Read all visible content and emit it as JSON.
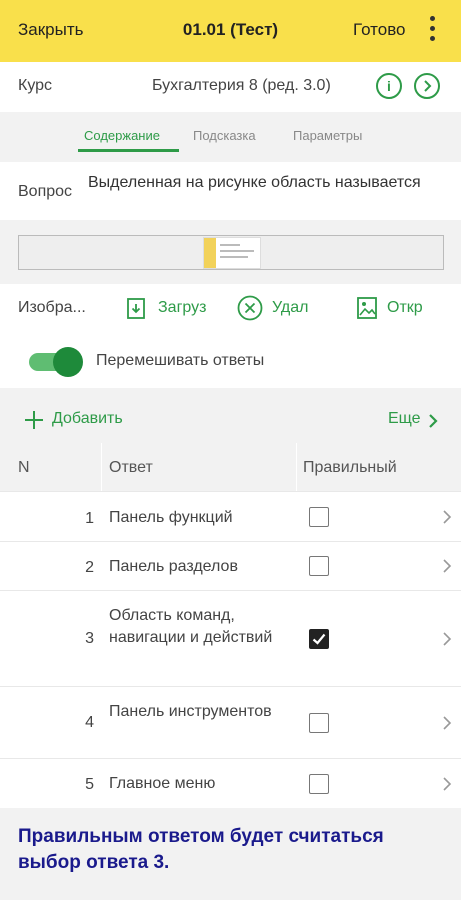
{
  "header": {
    "close_label": "Закрыть",
    "title": "01.01 (Тест)",
    "done_label": "Готово"
  },
  "course": {
    "label": "Курс",
    "value": "Бухгалтерия 8 (ред. 3.0)"
  },
  "tabs": [
    {
      "label": "Содержание",
      "active": true
    },
    {
      "label": "Подсказка",
      "active": false
    },
    {
      "label": "Параметры",
      "active": false
    }
  ],
  "question": {
    "label": "Вопрос",
    "text": "Выделенная на рисунке область называется"
  },
  "image_actions": {
    "label": "Изобра...",
    "upload": "Загруз",
    "delete": "Удал",
    "open": "Откр"
  },
  "shuffle": {
    "label": "Перемешивать ответы",
    "on": true
  },
  "toolbar": {
    "add_label": "Добавить",
    "more_label": "Еще"
  },
  "table": {
    "columns": [
      "N",
      "Ответ",
      "Правильный"
    ],
    "rows": [
      {
        "n": "1",
        "answer": "Панель функций",
        "correct": false
      },
      {
        "n": "2",
        "answer": "Панель разделов",
        "correct": false
      },
      {
        "n": "3",
        "answer": "Область команд, навигации и действий",
        "correct": true
      },
      {
        "n": "4",
        "answer": "Панель инструментов",
        "correct": false
      },
      {
        "n": "5",
        "answer": "Главное меню",
        "correct": false
      }
    ]
  },
  "footer": {
    "text": "Правильным ответом будет считаться выбор ответа 3."
  },
  "colors": {
    "header": "#f9e04b",
    "accent": "#2e9b48",
    "footer_text": "#1a1a8c"
  }
}
